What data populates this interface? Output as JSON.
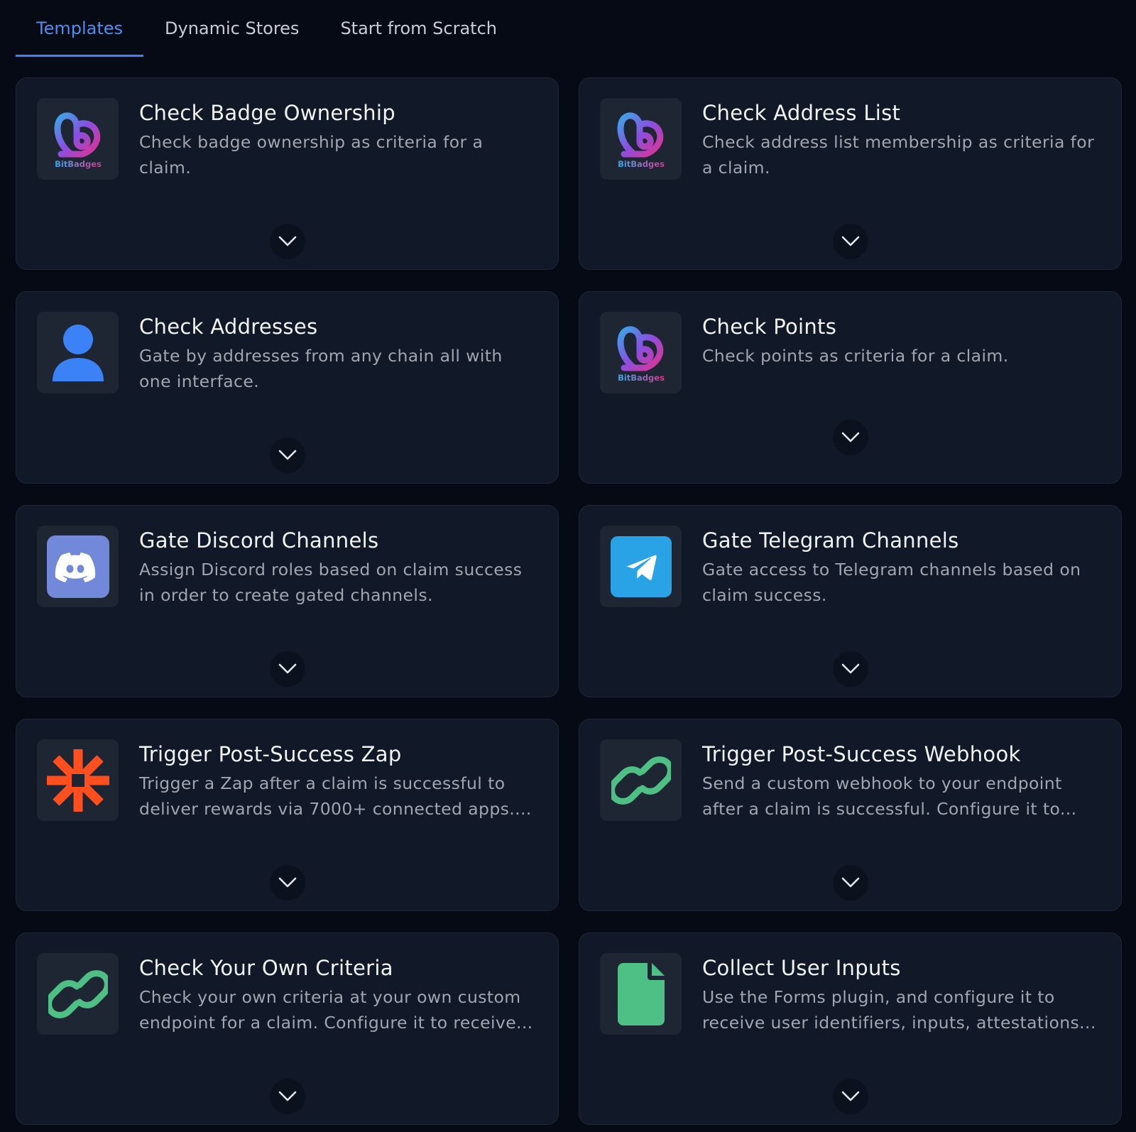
{
  "tabs": [
    {
      "label": "Templates",
      "active": true
    },
    {
      "label": "Dynamic Stores",
      "active": false
    },
    {
      "label": "Start from Scratch",
      "active": false
    }
  ],
  "brand_logo_text": "BitBadges",
  "cards": [
    {
      "title": "Check Badge Ownership",
      "description": "Check badge ownership as criteria for a claim.",
      "icon": "bitbadges-logo-icon"
    },
    {
      "title": "Check Address List",
      "description": "Check address list membership as criteria for a claim.",
      "icon": "bitbadges-logo-icon"
    },
    {
      "title": "Check Addresses",
      "description": "Gate by addresses from any chain all with one interface.",
      "icon": "user-icon"
    },
    {
      "title": "Check Points",
      "description": "Check points as criteria for a claim.",
      "icon": "bitbadges-logo-icon"
    },
    {
      "title": "Gate Discord Channels",
      "description": "Assign Discord roles based on claim success in order to create gated channels.",
      "icon": "discord-icon"
    },
    {
      "title": "Gate Telegram Channels",
      "description": "Gate access to Telegram channels based on claim success.",
      "icon": "telegram-icon"
    },
    {
      "title": "Trigger Post-Success Zap",
      "description": "Trigger a Zap after a claim is successful to deliver rewards via 7000+ connected apps....",
      "icon": "zapier-icon"
    },
    {
      "title": "Trigger Post-Success Webhook",
      "description": "Send a custom webhook to your endpoint after a claim is successful. Configure it to...",
      "icon": "link-icon"
    },
    {
      "title": "Check Your Own Criteria",
      "description": "Check your own criteria at your own custom endpoint for a claim. Configure it to receive...",
      "icon": "link-icon"
    },
    {
      "title": "Collect User Inputs",
      "description": "Use the Forms plugin, and configure it to receive user identifiers, inputs, attestations...",
      "icon": "document-icon"
    }
  ],
  "colors": {
    "background": "#050a14",
    "card": "#111827",
    "accent": "#3b82f6",
    "link_green": "#4ebf85",
    "zapier_orange": "#ff4f1f",
    "discord": "#7289da",
    "telegram": "#2aa3e6"
  }
}
